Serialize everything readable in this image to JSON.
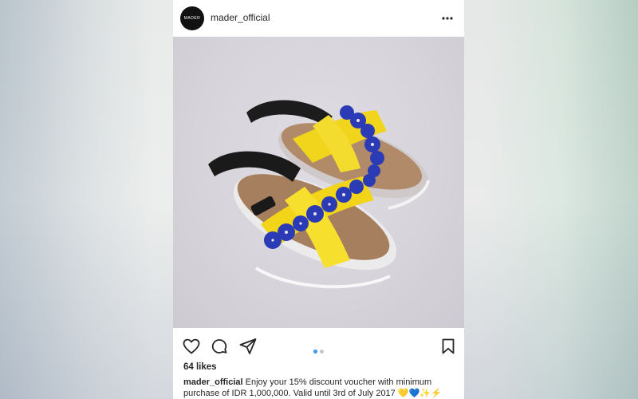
{
  "post": {
    "avatar_text": "MADER",
    "username": "mader_official",
    "likes": "64 likes",
    "caption_user": "mader_official",
    "caption_text": "Enjoy your 15% discount voucher with minimum purchase of IDR 1,000,000. Valid until 3rd of July 2017 💛💙✨⚡",
    "carousel": {
      "pages": 2,
      "current": 1
    },
    "colors": {
      "active_dot": "#3897f0",
      "inactive_dot": "#c7c7c7",
      "text": "#262626"
    }
  },
  "icons": {
    "more": "more-options-icon",
    "like": "heart-icon",
    "comment": "comment-icon",
    "share": "share-icon",
    "save": "bookmark-icon"
  }
}
